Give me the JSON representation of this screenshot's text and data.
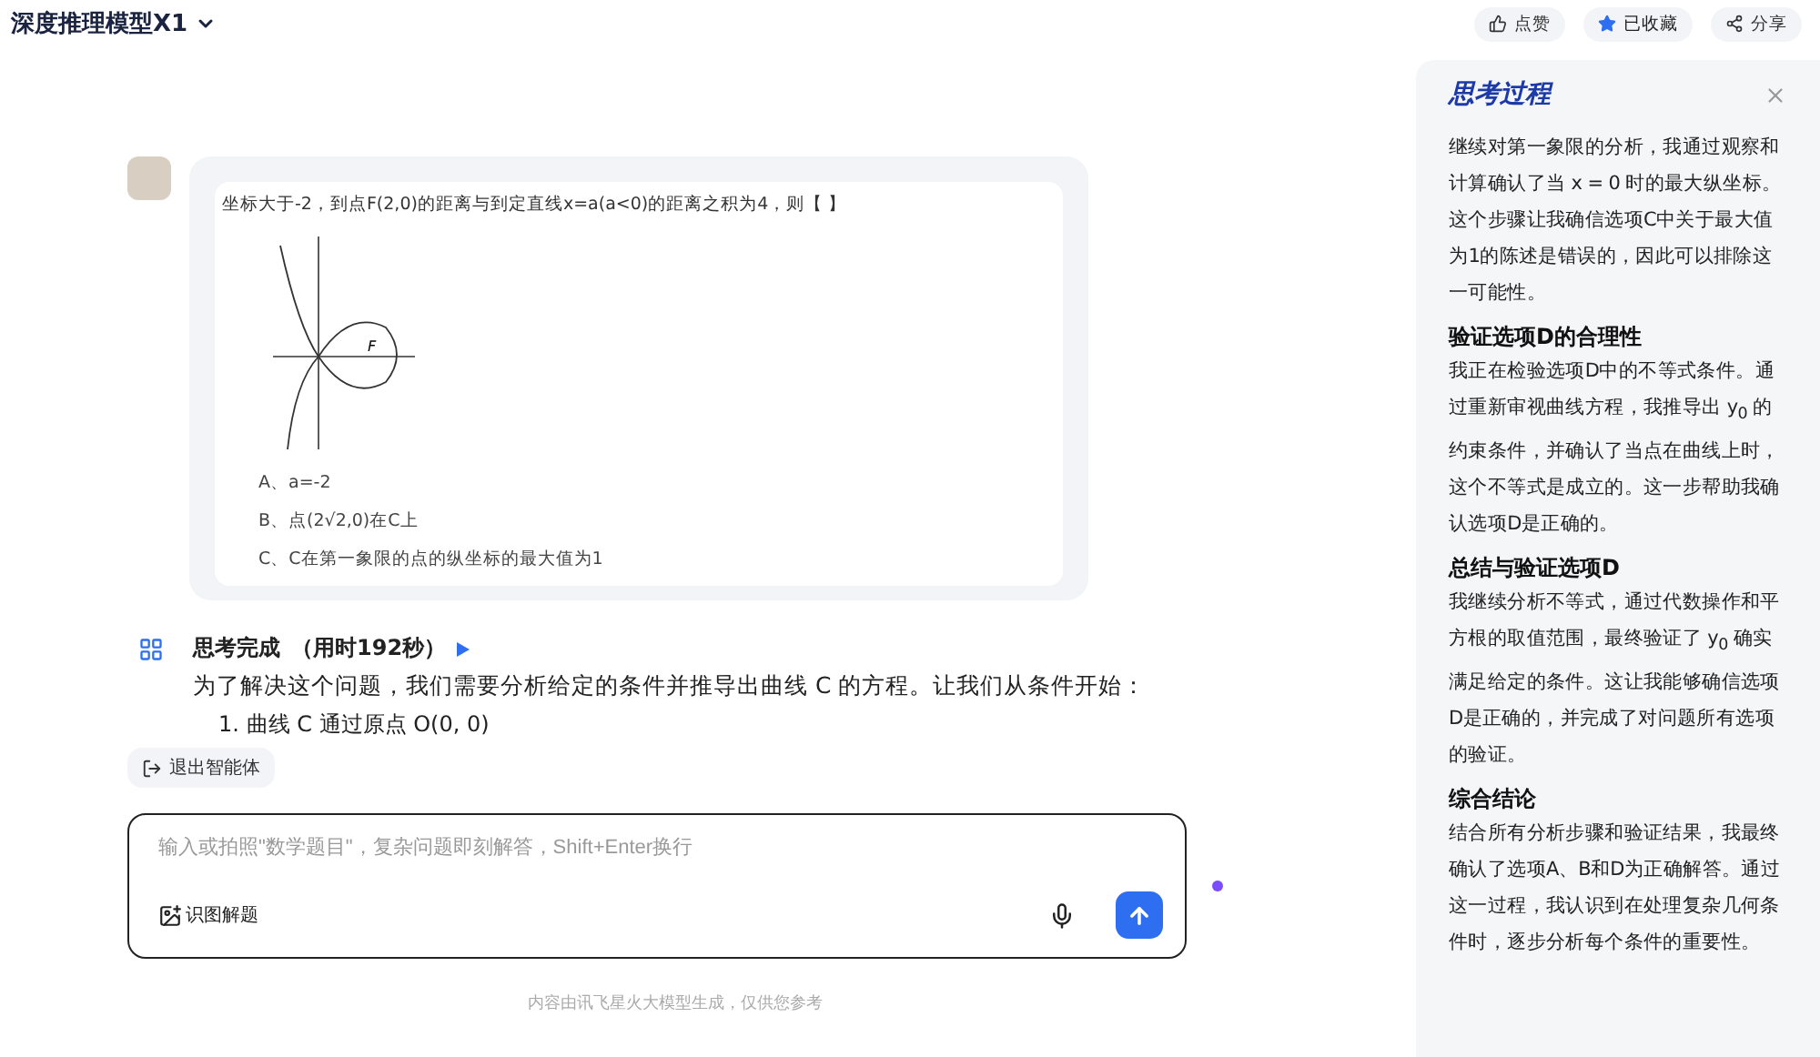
{
  "header": {
    "model_name": "深度推理模型X1",
    "actions": [
      {
        "kind": "like",
        "label": "点赞",
        "selected": false
      },
      {
        "kind": "favorite",
        "label": "已收藏",
        "selected": true
      },
      {
        "kind": "share",
        "label": "分享",
        "selected": false
      }
    ]
  },
  "question": {
    "text": "坐标大于-2，到点F(2,0)的距离与到定直线x=a(a<0)的距离之积为4，则【 】",
    "figure_label": "F",
    "options": [
      "A、a=-2",
      "B、点(2√2,0)在C上",
      "C、C在第一象限的点的纵坐标的最大值为1"
    ]
  },
  "answer": {
    "status": "思考完成",
    "duration": "（用时192秒）",
    "intro": "为了解决这个问题，我们需要分析给定的条件并推导出曲线 C 的方程。让我们从条件开始：",
    "first_step": "1. 曲线 C 通过原点 O(0, 0)"
  },
  "exit_button": "退出智能体",
  "input": {
    "placeholder": "输入或拍照\"数学题目\"，复杂问题即刻解答，Shift+Enter换行",
    "image_button": "识图解题"
  },
  "footer": "内容由讯飞星火大模型生成，仅供您参考",
  "panel": {
    "title": "思考过程",
    "sections": [
      {
        "body": "继续对第一象限的分析，我通过观察和计算确认了当 x = 0 时的最大纵坐标。这个步骤让我确信选项C中关于最大值为1的陈述是错误的，因此可以排除这一可能性。"
      },
      {
        "heading": "验证选项D的合理性",
        "body": "我正在检验选项D中的不等式条件。通过重新审视曲线方程，我推导出 y$_{0}$ 的约束条件，并确认了当点在曲线上时，这个不等式是成立的。这一步帮助我确认选项D是正确的。"
      },
      {
        "heading": "总结与验证选项D",
        "body": "我继续分析不等式，通过代数操作和平方根的取值范围，最终验证了 y$_{0}$ 确实满足给定的条件。这让我能够确信选项D是正确的，并完成了对问题所有选项的验证。"
      },
      {
        "heading": "综合结论",
        "body": "结合所有分析步骤和验证结果，我最终确认了选项A、B和D为正确解答。通过这一过程，我认识到在处理复杂几何条件时，逐步分析每个条件的重要性。"
      }
    ]
  }
}
